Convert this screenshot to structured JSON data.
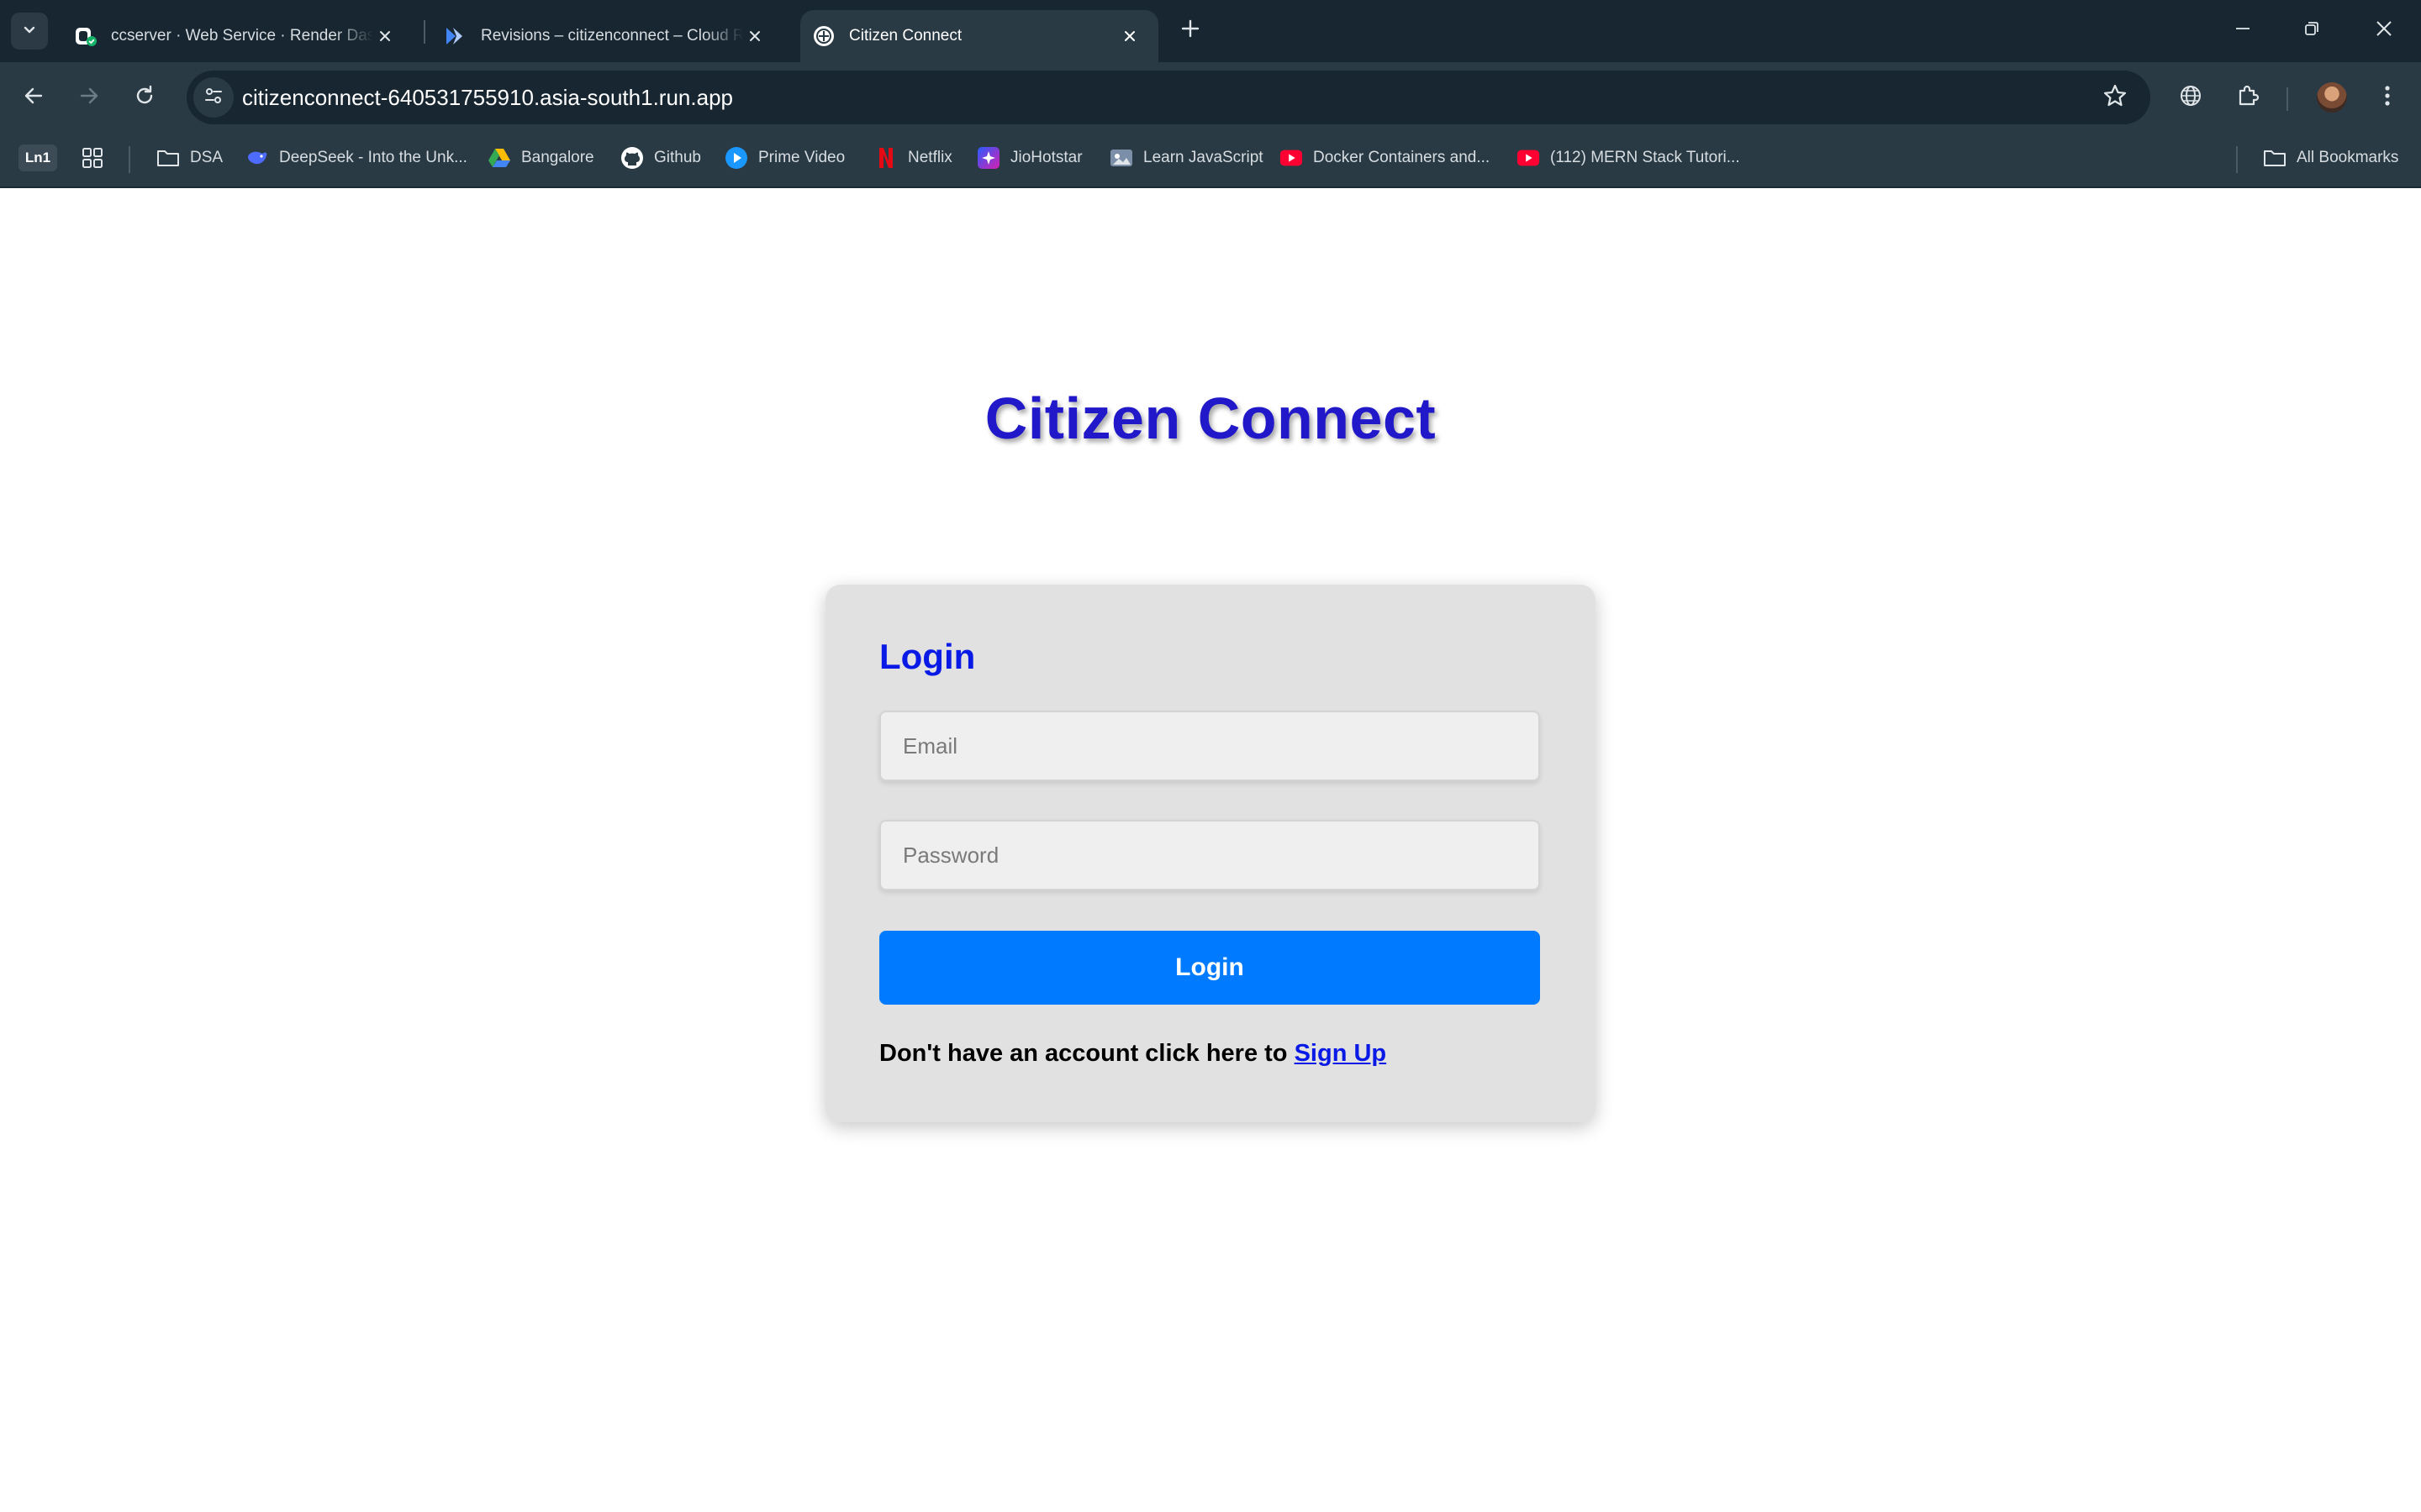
{
  "browser": {
    "tabs": [
      {
        "title": "ccserver · Web Service · Render Dashboard",
        "favicon": "render-icon",
        "active": false
      },
      {
        "title": "Revisions – citizenconnect – Cloud Run – Google Cloud",
        "favicon": "cloud-run-icon",
        "active": false
      },
      {
        "title": "Citizen Connect",
        "favicon": "citizen-connect-icon",
        "active": true
      }
    ],
    "url": "citizenconnect-640531755910.asia-south1.run.app",
    "bookmarks": {
      "profile_badge": "Ln1",
      "items": [
        {
          "label": "DSA",
          "icon": "folder-icon"
        },
        {
          "label": "DeepSeek - Into the Unk...",
          "icon": "deepseek-icon"
        },
        {
          "label": "Bangalore",
          "icon": "google-drive-icon"
        },
        {
          "label": "Github",
          "icon": "github-icon"
        },
        {
          "label": "Prime Video",
          "icon": "prime-video-icon"
        },
        {
          "label": "Netflix",
          "icon": "netflix-icon"
        },
        {
          "label": "JioHotstar",
          "icon": "jiohotstar-icon"
        },
        {
          "label": "Learn JavaScript",
          "icon": "learn-js-icon"
        },
        {
          "label": "Docker Containers and...",
          "icon": "youtube-icon"
        },
        {
          "label": "(112) MERN Stack Tutori...",
          "icon": "youtube-icon"
        }
      ],
      "all_bookmarks": "All Bookmarks"
    }
  },
  "page": {
    "title": "Citizen Connect",
    "login": {
      "heading": "Login",
      "email_placeholder": "Email",
      "email_value": "",
      "password_placeholder": "Password",
      "password_value": "",
      "button_label": "Login",
      "signup_prompt": "Don't have an account click here to ",
      "signup_link": "Sign Up"
    }
  },
  "colors": {
    "title": "#2119c9",
    "heading": "#0a1ae6",
    "button": "#007bff",
    "card": "#e1e1e1",
    "browser_frame": "#172630",
    "browser_toolbar": "#293a44"
  }
}
